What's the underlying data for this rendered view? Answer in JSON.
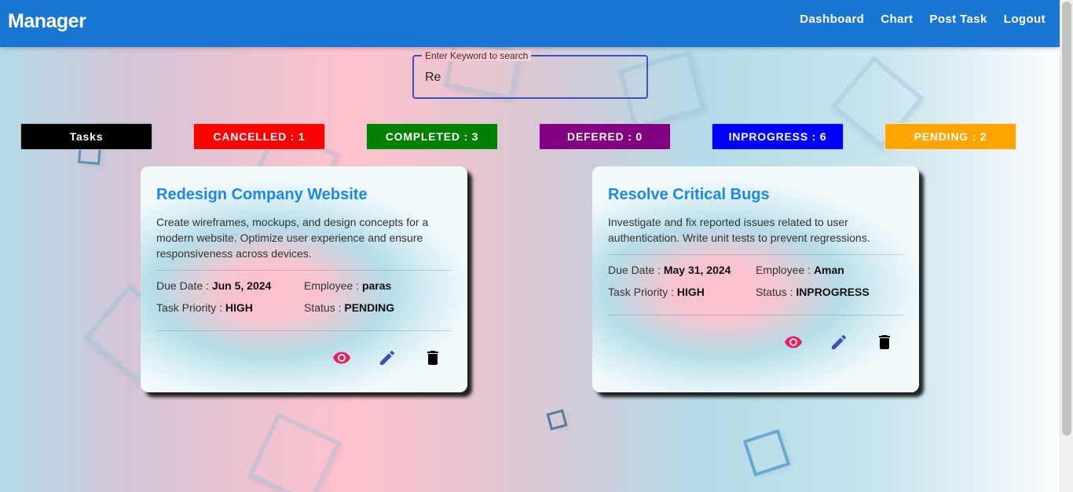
{
  "app": {
    "brand": "Manager"
  },
  "nav": [
    "Dashboard",
    "Chart",
    "Post Task",
    "Logout"
  ],
  "search": {
    "label": "Enter Keyword to search",
    "value": "Re"
  },
  "statuses": [
    {
      "label": "Tasks",
      "color": "#000000"
    },
    {
      "label": "CANCELLED : 1",
      "color": "#ff0000"
    },
    {
      "label": "COMPLETED : 3",
      "color": "#008000"
    },
    {
      "label": "DEFERED : 0",
      "color": "#800080"
    },
    {
      "label": "INPROGRESS : 6",
      "color": "#0000ff"
    },
    {
      "label": "PENDING : 2",
      "color": "#ffa500"
    }
  ],
  "tasks": [
    {
      "title": "Redesign Company Website",
      "description": "Create wireframes, mockups, and design concepts for a modern website. Optimize user experience and ensure responsiveness across devices.",
      "due_label": "Due Date :",
      "due": "Jun 5, 2024",
      "employee_label": "Employee :",
      "employee": "paras",
      "priority_label": "Task Priority :",
      "priority": "HIGH",
      "status_label": "Status :",
      "status": "PENDING"
    },
    {
      "title": "Resolve Critical Bugs",
      "description": "Investigate and fix reported issues related to user authentication. Write unit tests to prevent regressions.",
      "due_label": "Due Date :",
      "due": "May 31, 2024",
      "employee_label": "Employee :",
      "employee": "Aman",
      "priority_label": "Task Priority :",
      "priority": "HIGH",
      "status_label": "Status :",
      "status": "INPROGRESS"
    }
  ],
  "colors": {
    "appbar": "#1976d2",
    "title": "#1e88e5",
    "view_icon": "#e91e63",
    "edit_icon": "#3f51b5",
    "delete_icon": "#000000"
  },
  "icons": [
    "eye-icon",
    "pencil-icon",
    "trash-icon"
  ]
}
